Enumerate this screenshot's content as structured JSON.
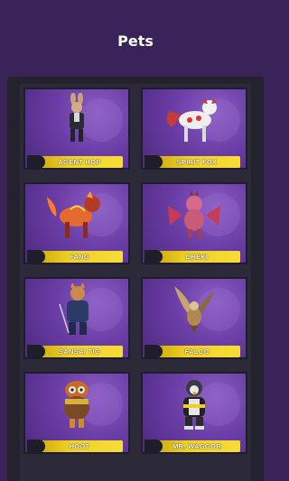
{
  "header": {
    "title": "Pets"
  },
  "pets": [
    {
      "name": "AGENT HOP",
      "icon": "rabbit-agent-icon"
    },
    {
      "name": "SPIRIT FOX",
      "icon": "spirit-fox-icon"
    },
    {
      "name": "FANG",
      "icon": "fire-wolf-icon"
    },
    {
      "name": "DREKI",
      "icon": "dragon-icon"
    },
    {
      "name": "SANSAI TIG",
      "icon": "ninja-tiger-icon"
    },
    {
      "name": "FALCO",
      "icon": "falcon-icon"
    },
    {
      "name": "HOOT",
      "icon": "owl-icon"
    },
    {
      "name": "MR. WAGGOR",
      "icon": "penguin-icon"
    }
  ]
}
